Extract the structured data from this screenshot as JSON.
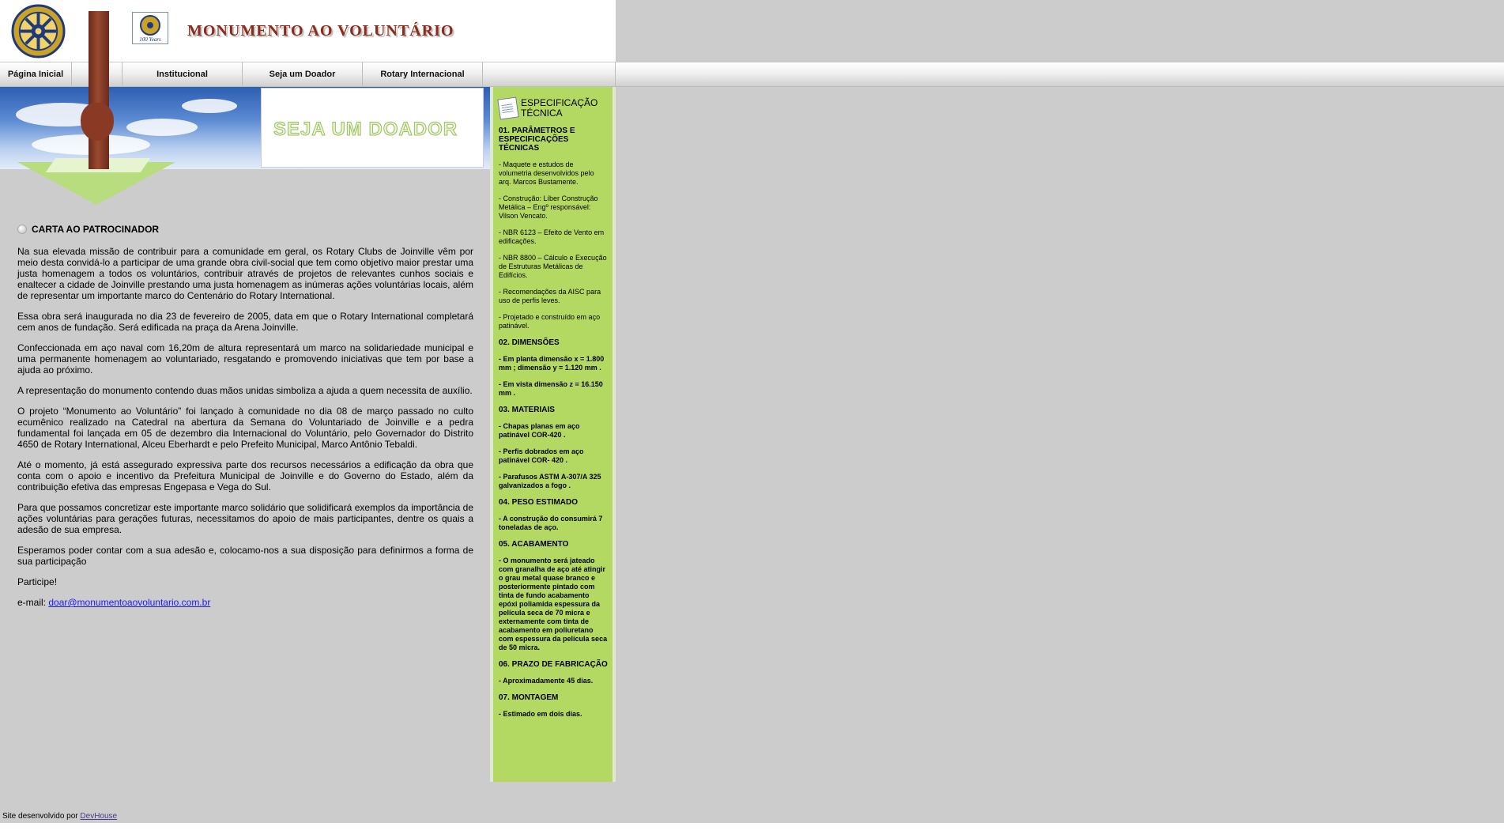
{
  "header": {
    "title": "MONUMENTO AO VOLUNTÁRIO",
    "badge_text": "100 Years"
  },
  "nav": {
    "items": [
      {
        "label": "Página Inicial"
      },
      {
        "label": ""
      },
      {
        "label": "Institucional"
      },
      {
        "label": "Seja um Doador"
      },
      {
        "label": "Rotary Internacional"
      },
      {
        "label": ""
      }
    ]
  },
  "banner": {
    "text": "SEJA UM DOADOR"
  },
  "main": {
    "heading": "CARTA AO PATROCINADOR",
    "paragraphs": [
      "Na sua elevada missão de contribuir para a comunidade em geral, os Rotary Clubs de Joinville vêm por meio desta convidá-lo a participar de uma grande obra civil-social que tem como objetivo maior prestar uma justa homenagem a todos os voluntários, contribuir através de projetos de relevantes cunhos sociais e enaltecer a cidade de Joinville prestando uma justa homenagem as inúmeras ações voluntárias locais, além de representar um importante marco do Centenário do Rotary International.",
      "Essa obra será inaugurada no dia 23 de fevereiro de 2005, data em que o Rotary International completará cem anos de fundação. Será edificada na praça da Arena Joinville.",
      "Confeccionada em aço naval com 16,20m de altura representará um marco na solidariedade municipal e uma permanente homenagem ao voluntariado, resgatando e promovendo iniciativas que tem por base a ajuda ao próximo.",
      "A representação do monumento contendo duas mãos unidas simboliza a ajuda a quem necessita de auxílio.",
      "O projeto “Monumento ao Voluntário” foi lançado à comunidade no dia 08 de março passado no culto ecumênico realizado na Catedral na abertura da Semana do Voluntariado de Joinville e a pedra fundamental foi lançada em 05 de dezembro dia Internacional do Voluntário, pelo Governador do Distrito 4650 de Rotary International, Alceu Eberhardt e pelo Prefeito Municipal, Marco Antônio Tebaldi.",
      "Até o momento, já está assegurado expressiva parte dos recursos necessários a edificação da obra que conta com o apoio e incentivo da Prefeitura Municipal de Joinville e do Governo do Estado, além da contribuição efetiva das empresas Engepasa e Vega do Sul.",
      "Para que possamos concretizar este importante marco solidário que solidificará exemplos da importância de ações voluntárias para gerações futuras, necessitamos do apoio de mais participantes, dentre os quais a adesão de sua empresa.",
      "Esperamos poder contar com a sua adesão e, colocamo-nos a sua disposição para definirmos a forma de sua participação",
      "Participe!"
    ],
    "email_label": "e-mail:",
    "email": "doar@monumentoaovoluntario.com.br"
  },
  "sidebar": {
    "title": "ESPECIFICAÇÃO TÉCNICA",
    "s1_title": "01. PARÂMETROS E ESPECIFICAÇÕES TÉCNICAS",
    "s1_items": [
      "- Maquete e estudos de volumetria desenvolvidos pelo arq. Marcos Bustamente.",
      "- Construção: Líber Construção Metálica – Engº responsável: Vilson Vencato.",
      "- NBR 6123 – Efeito de Vento em edificações.",
      "- NBR 8800 – Cálculo e Execução de Estruturas Metálicas de Edifícios.",
      "- Recomendações da AISC para uso de perfis leves.",
      "- Projetado e construído em aço patinável."
    ],
    "s2_title": "02. DIMENSÕES",
    "s2_items": [
      "- Em planta dimensão x = 1.800 mm ; dimensão y = 1.120 mm .",
      "- Em vista dimensão z = 16.150 mm ."
    ],
    "s3_title": "03. MATERIAIS",
    "s3_items": [
      "- Chapas planas em aço patinável COR-420 .",
      "- Perfis dobrados em aço patinável COR- 420 .",
      "- Parafusos ASTM A-307/A 325 galvanizados a fogo ."
    ],
    "s4_title": "04. PESO ESTIMADO",
    "s4_items": [
      "- A construção do consumirá 7 toneladas de aço."
    ],
    "s5_title": "05. ACABAMENTO",
    "s5_items": [
      "- O monumento será jateado com granalha de aço até atingir o grau metal quase branco e posteriormente pintado com tinta de fundo acabamento epóxi poliamida espessura da película seca de 70 micra e externamente com tinta de acabamento em poliuretano com espessura da película seca de 50 micra."
    ],
    "s6_title": "06. PRAZO DE FABRICAÇÃO",
    "s6_items": [
      "- Aproximadamente 45 dias."
    ],
    "s7_title": "07. MONTAGEM",
    "s7_items": [
      "- Estimado em dois dias."
    ]
  },
  "footer": {
    "text": "Site desenvolvido por",
    "link": "DevHouse"
  },
  "colors": {
    "sidebar_bg": "#b4d963",
    "page_bg": "#cccccc",
    "title": "#8e2b1a"
  }
}
